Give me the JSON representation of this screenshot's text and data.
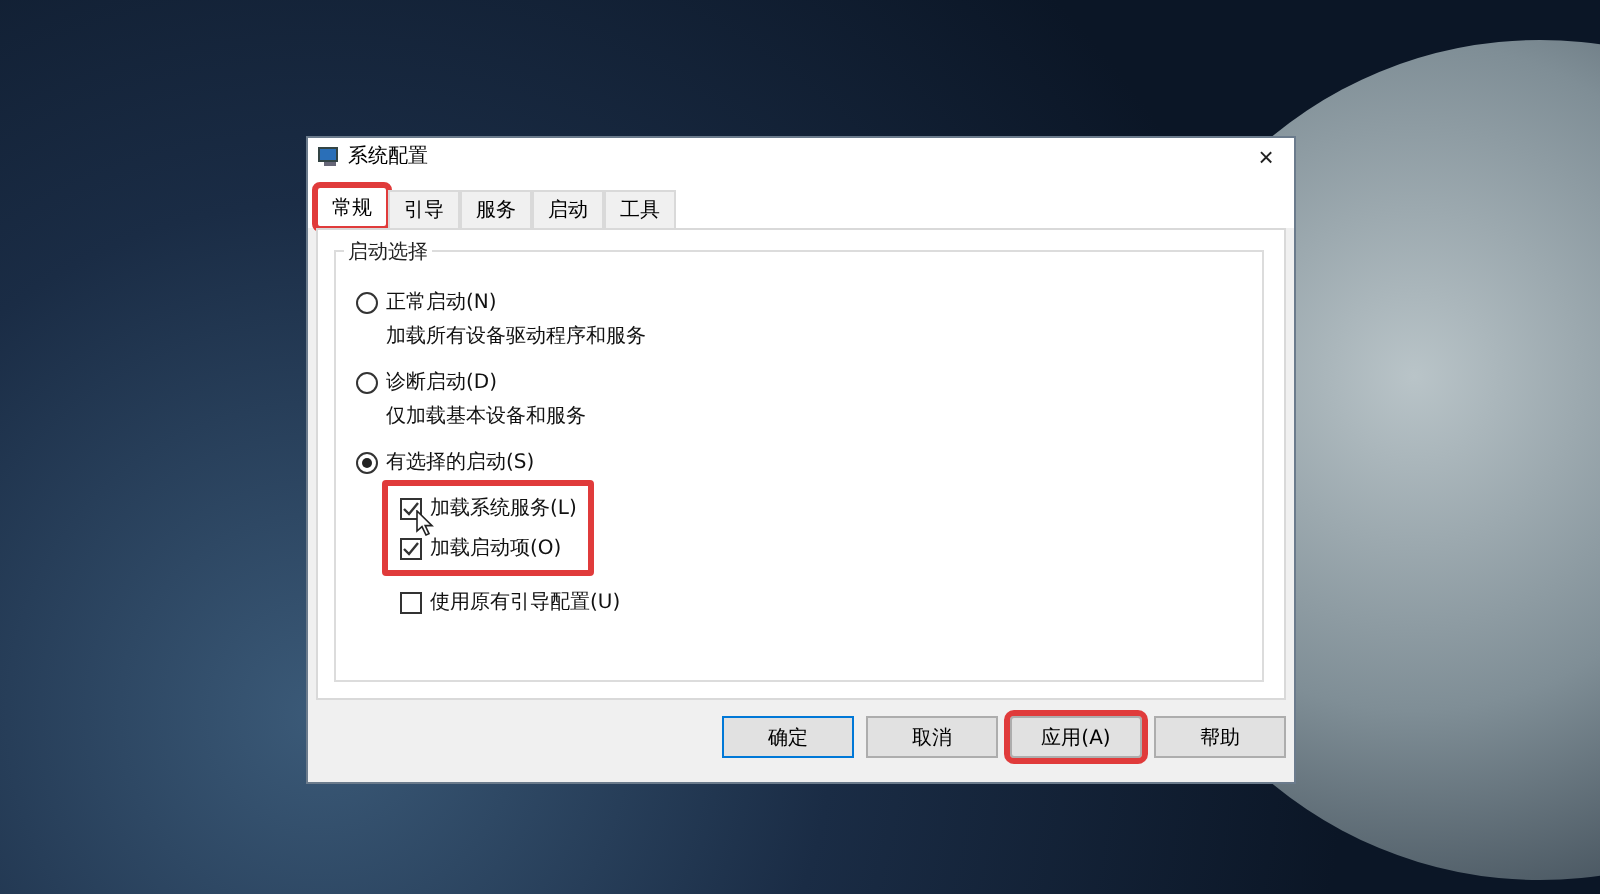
{
  "window": {
    "title": "系统配置",
    "close": "×"
  },
  "tabs": [
    {
      "label": "常规",
      "selected": true,
      "highlighted": true
    },
    {
      "label": "引导",
      "selected": false,
      "highlighted": false
    },
    {
      "label": "服务",
      "selected": false,
      "highlighted": false
    },
    {
      "label": "启动",
      "selected": false,
      "highlighted": false
    },
    {
      "label": "工具",
      "selected": false,
      "highlighted": false
    }
  ],
  "group": {
    "title": "启动选择",
    "radios": [
      {
        "label": "正常启动(N)",
        "description": "加载所有设备驱动程序和服务",
        "selected": false
      },
      {
        "label": "诊断启动(D)",
        "description": "仅加载基本设备和服务",
        "selected": false
      },
      {
        "label": "有选择的启动(S)",
        "selected": true
      }
    ],
    "checkboxes": [
      {
        "label": "加载系统服务(L)",
        "checked": true,
        "highlighted": true
      },
      {
        "label": "加载启动项(O)",
        "checked": true,
        "highlighted": true
      },
      {
        "label": "使用原有引导配置(U)",
        "checked": false,
        "highlighted": false
      }
    ]
  },
  "buttons": [
    {
      "label": "确定",
      "highlighted": false,
      "default": true
    },
    {
      "label": "取消",
      "highlighted": false,
      "default": false
    },
    {
      "label": "应用(A)",
      "highlighted": true,
      "default": false
    },
    {
      "label": "帮助",
      "highlighted": false,
      "default": false
    }
  ]
}
